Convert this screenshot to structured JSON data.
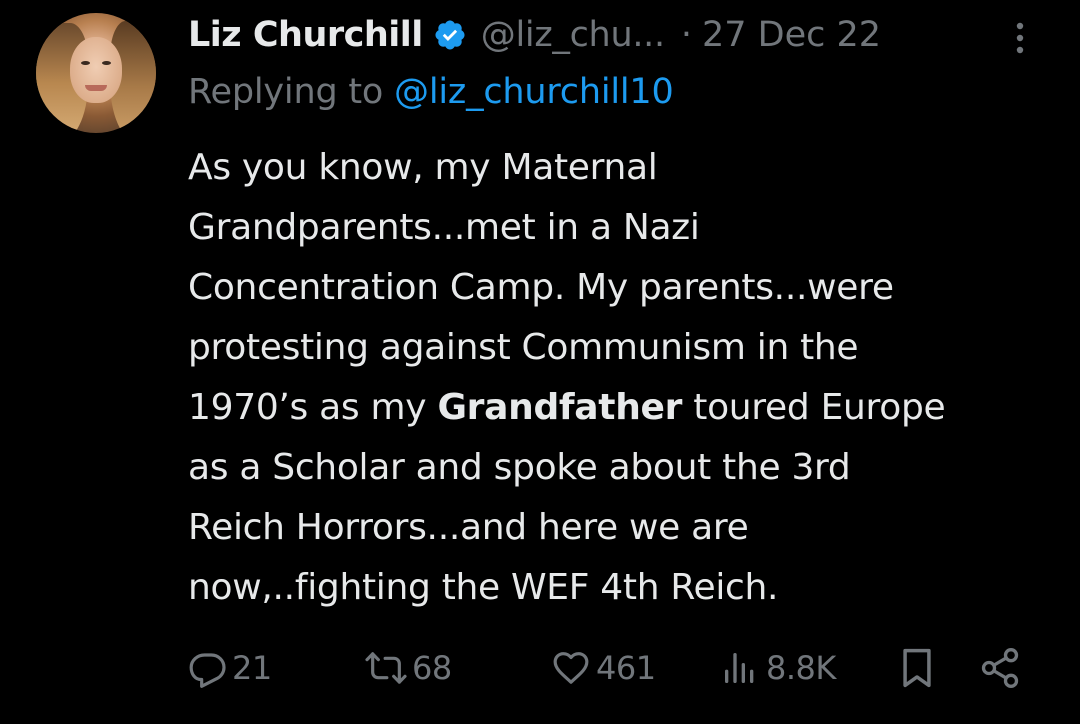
{
  "tweet": {
    "author": {
      "name": "Liz Churchill",
      "handle": "@liz_chu...",
      "verified": true,
      "avatar_icon": "profile-photo"
    },
    "date": "27 Dec 22",
    "separator": "·",
    "replying_prefix": "Replying to ",
    "replying_to": "@liz_churchill10",
    "body": {
      "line1": "As you know, my Maternal",
      "line2": "Grandparents...met in a Nazi",
      "line3": "Concentration Camp. My parents...were",
      "line4": "protesting against Communism in the",
      "line5_pre": "1970’s as my ",
      "line5_bold": "Grandfather",
      "line5_post": " toured Europe",
      "line6": "as a Scholar and spoke about the 3rd",
      "line7": "Reich Horrors...and here we are",
      "line8": "now,..fighting the WEF 4th Reich."
    },
    "stats": {
      "replies": "21",
      "retweets": "68",
      "likes": "461",
      "views": "8.8K"
    }
  },
  "colors": {
    "background": "#000000",
    "text": "#e7e9ea",
    "muted": "#71767b",
    "accent": "#1d9bf0"
  },
  "icons": [
    "verified-badge-icon",
    "more-options-icon",
    "reply-icon",
    "retweet-icon",
    "like-icon",
    "views-icon",
    "bookmark-icon",
    "share-icon"
  ]
}
